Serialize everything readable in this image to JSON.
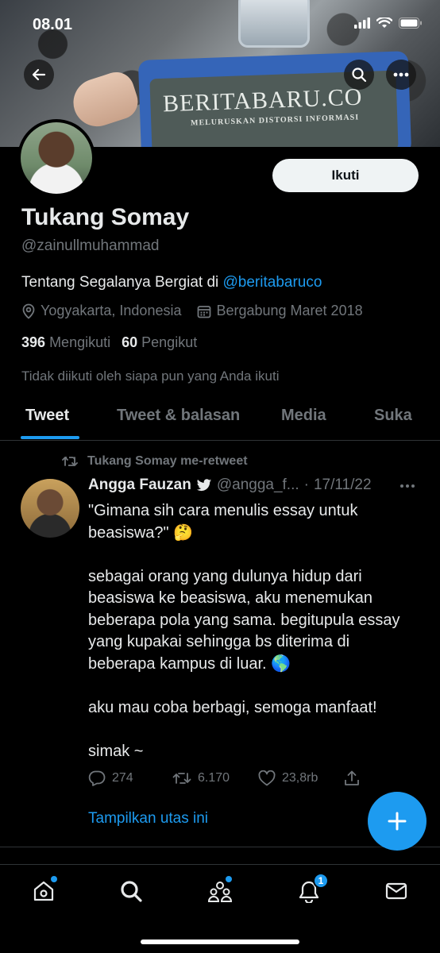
{
  "status_bar": {
    "time": "08.01"
  },
  "banner": {
    "brand": "BERITABARU.CO",
    "tagline": "MELURUSKAN DISTORSI INFORMASI"
  },
  "profile": {
    "follow_button": "Ikuti",
    "name": "Tukang Somay",
    "handle": "@zainullmuhammad",
    "bio_text": "Tentang Segalanya Bergiat di ",
    "bio_link": "@beritabaruco",
    "location": "Yogyakarta, Indonesia",
    "joined": "Bergabung Maret 2018",
    "following_count": "396",
    "following_label": "Mengikuti",
    "followers_count": "60",
    "followers_label": "Pengikut",
    "not_followed_note": "Tidak diikuti oleh siapa pun yang Anda ikuti"
  },
  "tabs": [
    {
      "label": "Tweet",
      "active": true
    },
    {
      "label": "Tweet & balasan",
      "active": false
    },
    {
      "label": "Media",
      "active": false
    },
    {
      "label": "Suka",
      "active": false
    }
  ],
  "tweet": {
    "retweet_note": "Tukang Somay me-retweet",
    "author": "Angga Fauzan",
    "handle": "@angga_f...",
    "separator": "·",
    "date": "17/11/22",
    "lines": [
      "\"Gimana sih cara menulis essay untuk",
      "beasiswa?\" 🤔",
      "",
      "sebagai orang yang dulunya hidup dari",
      "beasiswa ke beasiswa, aku menemukan",
      "beberapa pola yang sama. begitupula essay",
      "yang kupakai sehingga bs diterima di",
      "beberapa kampus di luar. 🌎",
      "",
      "aku mau coba berbagi, semoga manfaat!",
      "",
      "simak ~"
    ],
    "replies": "274",
    "retweets": "6.170",
    "likes": "23,8rb",
    "show_thread": "Tampilkan utas ini"
  },
  "bottom_nav": {
    "notifications_badge": "1",
    "items": [
      "home-icon",
      "search-icon",
      "communities-icon",
      "notifications-icon",
      "messages-icon"
    ]
  },
  "colors": {
    "accent": "#1d9bf0",
    "muted": "#71767b",
    "text": "#e7e9ea",
    "background": "#000000"
  }
}
